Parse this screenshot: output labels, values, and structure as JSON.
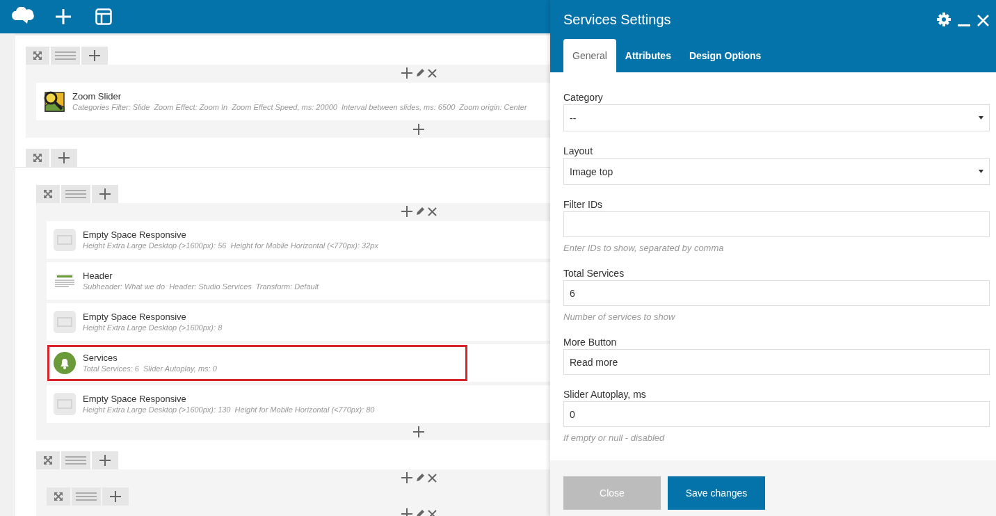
{
  "builder": [
    {
      "kind": "row",
      "columns": [
        {
          "items": [
            {
              "kind": "zoom-slider",
              "title": "Zoom Slider",
              "params": "Categories Filter: Slide  Zoom Effect: Zoom In  Zoom Effect Speed, ms: 20000  Interval between slides, ms: 6500  Zoom origin: Center",
              "selected": false
            }
          ]
        }
      ]
    },
    {
      "kind": "section",
      "children": [
        {
          "kind": "row",
          "columns": [
            {
              "items": [
                {
                  "kind": "empty-space",
                  "title": "Empty Space Responsive",
                  "params": "Height Extra Large Desktop (>1600px): 56  Height for Mobile Horizontal (<770px): 32px",
                  "selected": false
                },
                {
                  "kind": "header",
                  "title": "Header",
                  "params": "Subheader: What we do  Header: Studio Services  Transform: Default",
                  "selected": false
                },
                {
                  "kind": "empty-space",
                  "title": "Empty Space Responsive",
                  "params": "Height Extra Large Desktop (>1600px): 8",
                  "selected": false
                },
                {
                  "kind": "services",
                  "title": "Services",
                  "params": "Total Services: 6  Slider Autoplay, ms: 0",
                  "selected": true
                },
                {
                  "kind": "empty-space",
                  "title": "Empty Space Responsive",
                  "params": "Height Extra Large Desktop (>1600px): 130  Height for Mobile Horizontal (<770px): 80",
                  "selected": false
                }
              ]
            }
          ]
        },
        {
          "kind": "row",
          "columns": [
            {
              "items": [
                {
                  "kind": "row",
                  "columns": [
                    {}
                  ]
                }
              ]
            }
          ]
        }
      ]
    }
  ],
  "panel": {
    "title": "Services Settings",
    "tabs": [
      {
        "label": "General",
        "selected": true
      },
      {
        "label": "Attributes",
        "selected": false
      },
      {
        "label": "Design Options",
        "selected": false
      }
    ],
    "fields": [
      {
        "kind": "select",
        "label": "Category",
        "value": "--"
      },
      {
        "kind": "select",
        "label": "Layout",
        "value": "Image top"
      },
      {
        "kind": "text",
        "label": "Filter IDs",
        "help": "Enter IDs to show, separated by comma"
      },
      {
        "kind": "text",
        "label": "Total Services",
        "value": "6",
        "help": "Number of services to show"
      },
      {
        "kind": "text",
        "label": "More Button",
        "value": "Read more"
      },
      {
        "kind": "text",
        "label": "Slider Autoplay, ms",
        "value": "0",
        "help": "If empty or null - disabled"
      }
    ],
    "buttons": [
      {
        "kind": "secondary",
        "label": "Close"
      },
      {
        "kind": "primary",
        "label": "Save changes"
      }
    ]
  }
}
